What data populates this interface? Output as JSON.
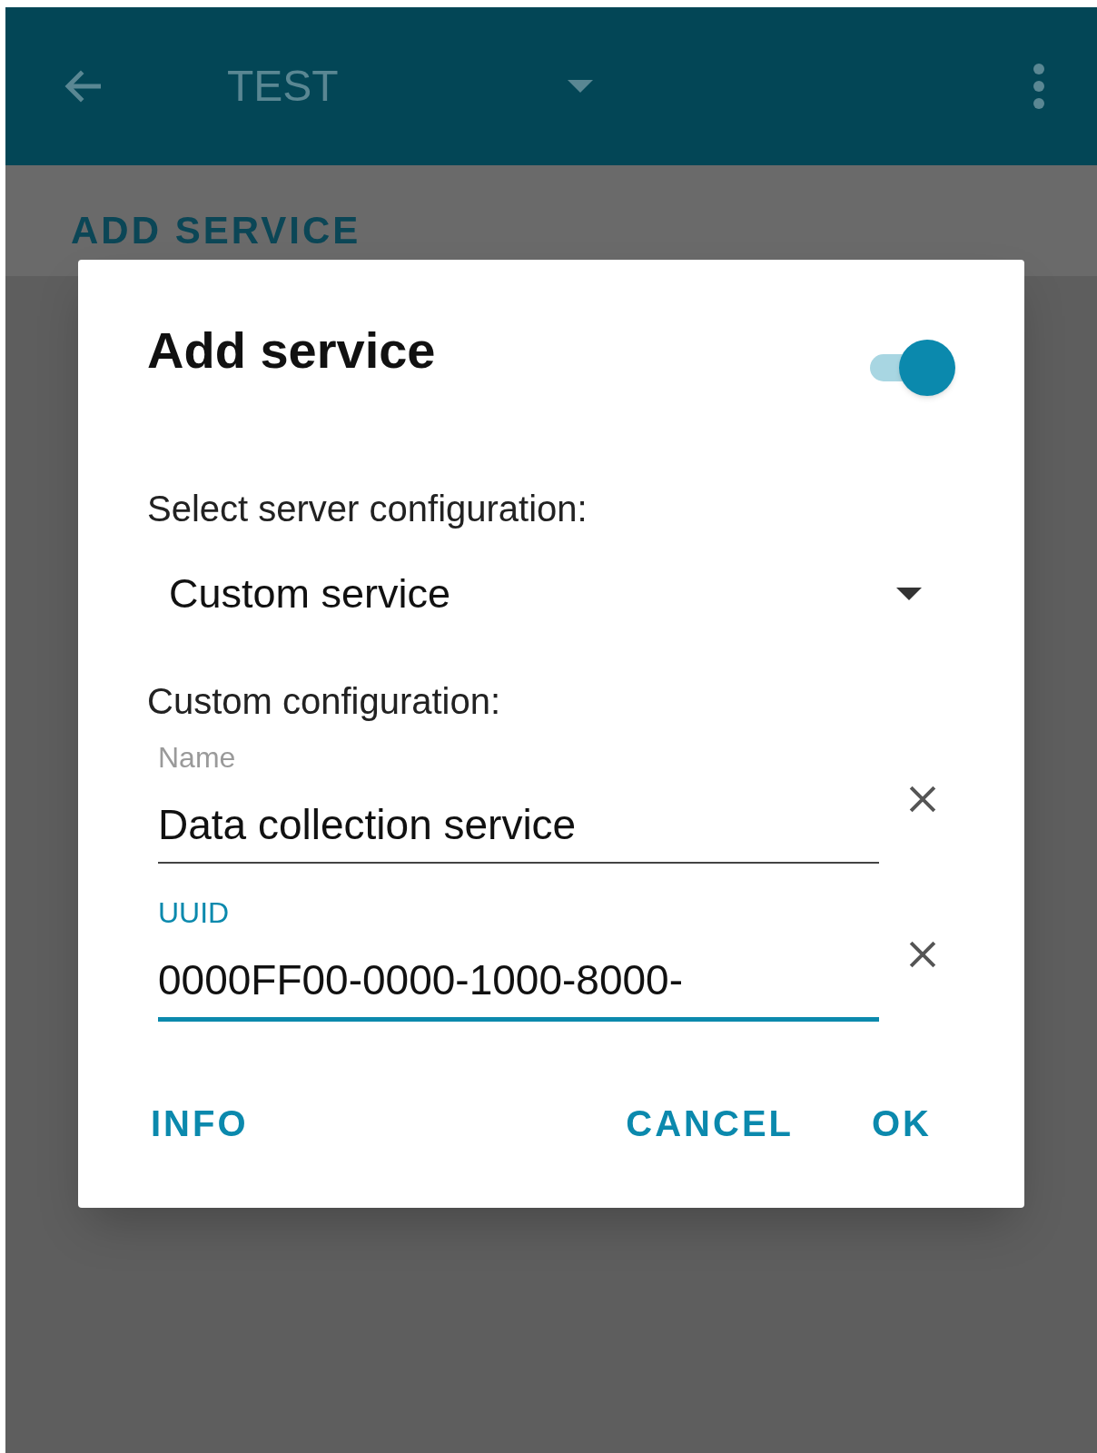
{
  "app_bar": {
    "title": "TEST"
  },
  "tab": {
    "label": "ADD SERVICE"
  },
  "dialog": {
    "title": "Add service",
    "switch": {
      "on": true
    },
    "select_label": "Select server configuration:",
    "select": {
      "value": "Custom service"
    },
    "custom_label": "Custom configuration:",
    "fields": [
      {
        "label": "Name",
        "value": "Data collection service",
        "focused": false
      },
      {
        "label": "UUID",
        "value": "0000FF00-0000-1000-8000-",
        "focused": true
      }
    ],
    "buttons": [
      {
        "label": "INFO"
      },
      {
        "label": "CANCEL"
      },
      {
        "label": "OK"
      }
    ]
  }
}
